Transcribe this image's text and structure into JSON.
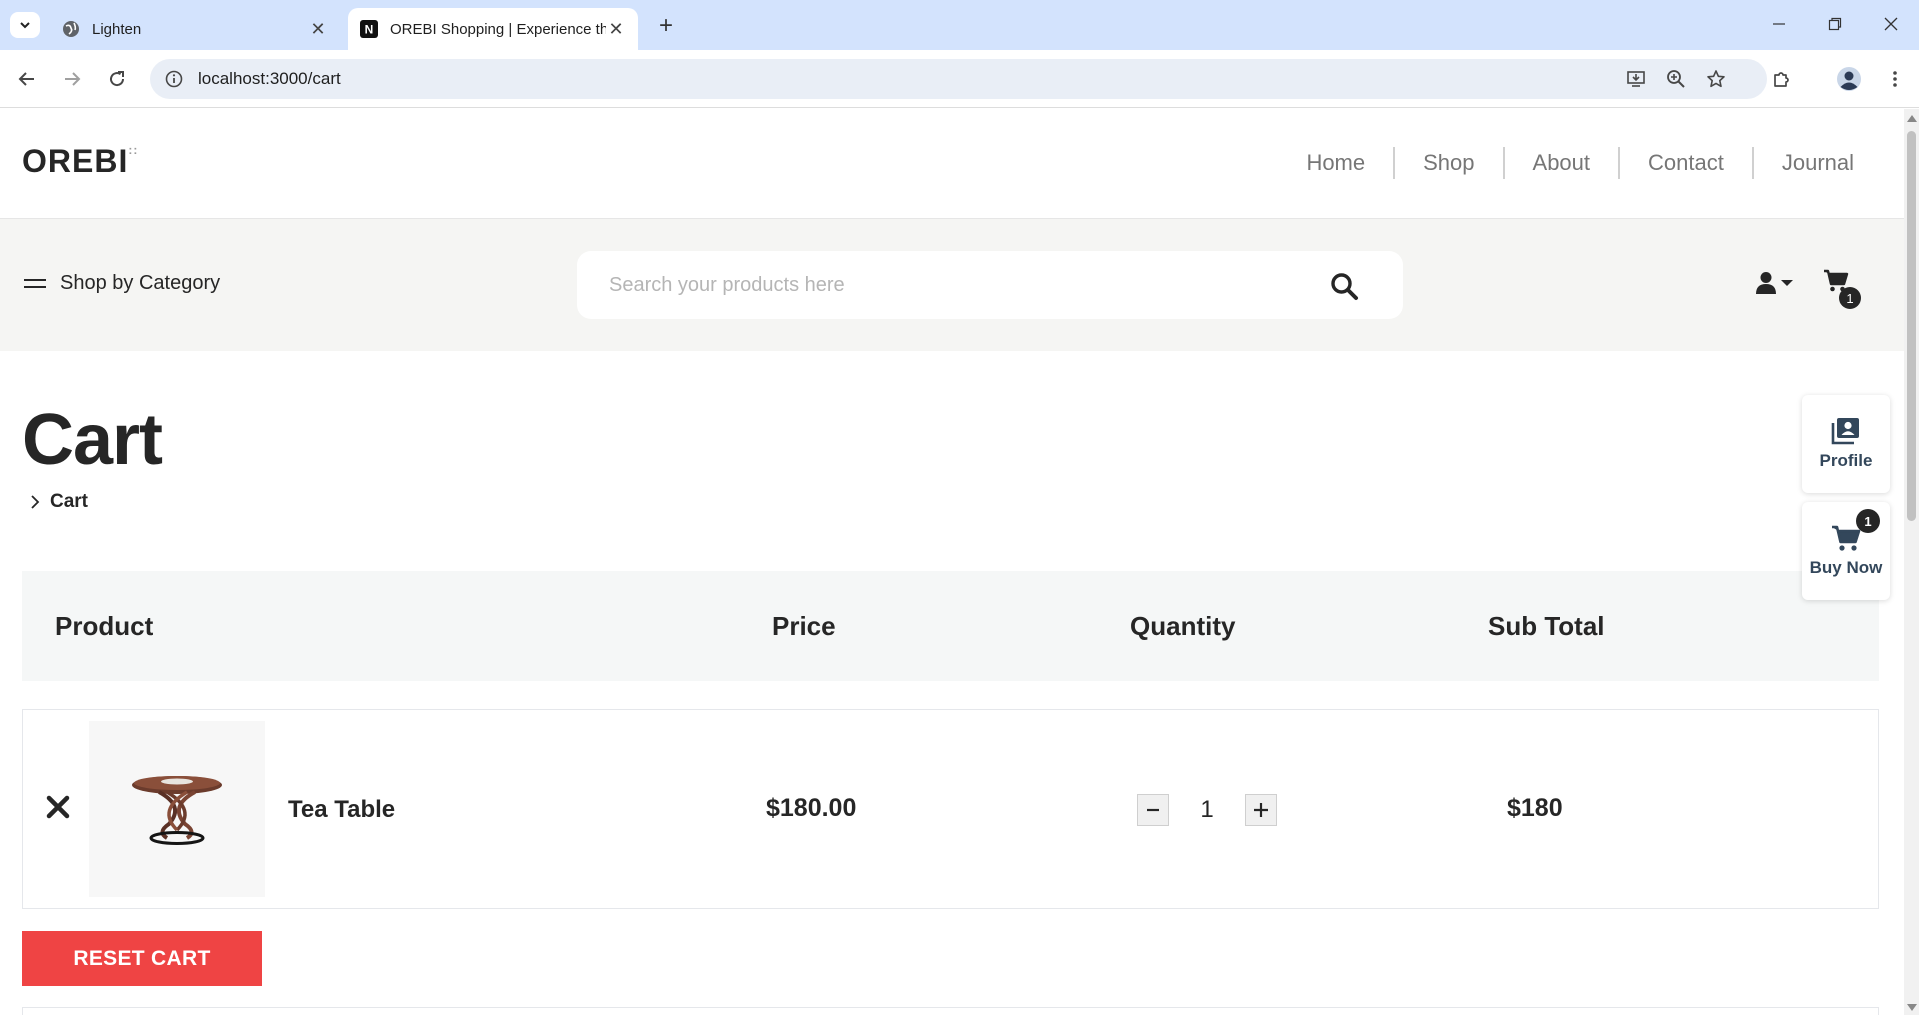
{
  "browser": {
    "tabs": [
      {
        "title": "Lighten"
      },
      {
        "title": "OREBI Shopping | Experience th"
      }
    ],
    "url": "localhost:3000/cart"
  },
  "site": {
    "logo": "OREBI",
    "nav": [
      "Home",
      "Shop",
      "About",
      "Contact",
      "Journal"
    ],
    "category_label": "Shop by Category",
    "search_placeholder": "Search your products here",
    "cart_count": "1"
  },
  "page": {
    "title": "Cart",
    "breadcrumb": "Cart"
  },
  "table": {
    "headers": [
      "Product",
      "Price",
      "Quantity",
      "Sub Total"
    ],
    "items": [
      {
        "name": "Tea Table",
        "price": "$180.00",
        "quantity": "1",
        "subtotal": "$180"
      }
    ]
  },
  "actions": {
    "reset_label": "RESET CART"
  },
  "float": {
    "profile_label": "Profile",
    "buy_label": "Buy Now",
    "buy_badge": "1"
  },
  "colors": {
    "reset_button": "#ef4444",
    "accent_text": "#262626",
    "float_label": "#33475b"
  }
}
